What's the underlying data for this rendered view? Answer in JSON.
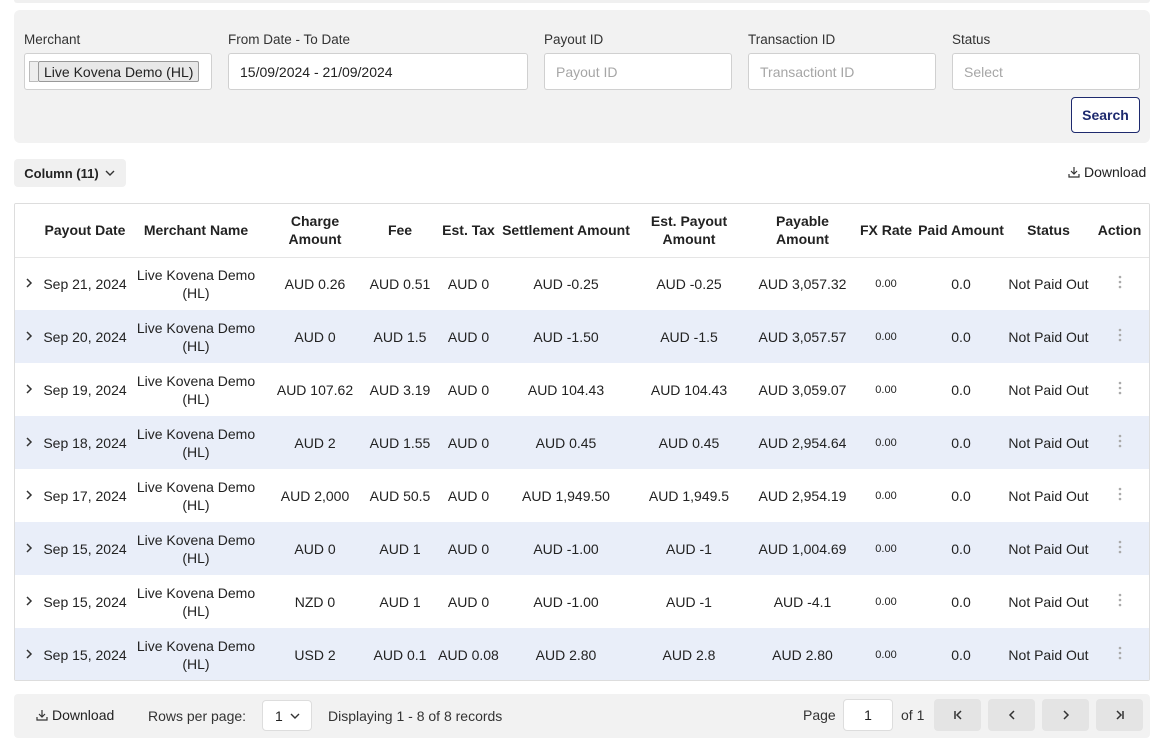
{
  "filters": {
    "merchant_label": "Merchant",
    "merchant_value": "Live Kovena Demo (HL)",
    "date_label": "From Date - To Date",
    "date_value": "15/09/2024 - 21/09/2024",
    "payout_id_label": "Payout ID",
    "payout_id_placeholder": "Payout ID",
    "transaction_id_label": "Transaction ID",
    "transaction_id_placeholder": "Transactiont ID",
    "status_label": "Status",
    "status_placeholder": "Select",
    "search_label": "Search"
  },
  "toolbar": {
    "column_label": "Column (11)",
    "download_label": "Download"
  },
  "table": {
    "headers": [
      "",
      "Payout Date",
      "Merchant Name",
      "Charge Amount",
      "Fee",
      "Est. Tax",
      "Settlement Amount",
      "Est. Payout Amount",
      "Payable Amount",
      "FX Rate",
      "Paid Amount",
      "Status",
      "Action"
    ],
    "rows": [
      [
        "Sep 21, 2024",
        "Live Kovena Demo (HL)",
        "AUD 0.26",
        "AUD 0.51",
        "AUD 0",
        "AUD -0.25",
        "AUD -0.25",
        "AUD 3,057.32",
        "0.00",
        "0.0",
        "Not Paid Out"
      ],
      [
        "Sep 20, 2024",
        "Live Kovena Demo (HL)",
        "AUD 0",
        "AUD 1.5",
        "AUD 0",
        "AUD -1.50",
        "AUD -1.5",
        "AUD 3,057.57",
        "0.00",
        "0.0",
        "Not Paid Out"
      ],
      [
        "Sep 19, 2024",
        "Live Kovena Demo (HL)",
        "AUD 107.62",
        "AUD 3.19",
        "AUD 0",
        "AUD 104.43",
        "AUD 104.43",
        "AUD 3,059.07",
        "0.00",
        "0.0",
        "Not Paid Out"
      ],
      [
        "Sep 18, 2024",
        "Live Kovena Demo (HL)",
        "AUD 2",
        "AUD 1.55",
        "AUD 0",
        "AUD 0.45",
        "AUD 0.45",
        "AUD 2,954.64",
        "0.00",
        "0.0",
        "Not Paid Out"
      ],
      [
        "Sep 17, 2024",
        "Live Kovena Demo (HL)",
        "AUD 2,000",
        "AUD 50.5",
        "AUD 0",
        "AUD 1,949.50",
        "AUD 1,949.5",
        "AUD 2,954.19",
        "0.00",
        "0.0",
        "Not Paid Out"
      ],
      [
        "Sep 15, 2024",
        "Live Kovena Demo (HL)",
        "AUD 0",
        "AUD 1",
        "AUD 0",
        "AUD -1.00",
        "AUD -1",
        "AUD 1,004.69",
        "0.00",
        "0.0",
        "Not Paid Out"
      ],
      [
        "Sep 15, 2024",
        "Live Kovena Demo (HL)",
        "NZD 0",
        "AUD 1",
        "AUD 0",
        "AUD -1.00",
        "AUD -1",
        "AUD -4.1",
        "0.00",
        "0.0",
        "Not Paid Out"
      ],
      [
        "Sep 15, 2024",
        "Live Kovena Demo (HL)",
        "USD 2",
        "AUD 0.1",
        "AUD 0.08",
        "AUD 2.80",
        "AUD 2.8",
        "AUD 2.80",
        "0.00",
        "0.0",
        "Not Paid Out"
      ]
    ]
  },
  "footer": {
    "download_label": "Download",
    "rows_per_page_label": "Rows per page:",
    "rows_per_page_value": "1",
    "displaying": "Displaying 1 - 8 of 8 records",
    "page_label": "Page",
    "page_value": "1",
    "of_label": "of 1"
  },
  "colors": {
    "accent": "#1e2a6e",
    "row_alt": "#e9eef9",
    "panel_bg": "#f2f2f2"
  }
}
